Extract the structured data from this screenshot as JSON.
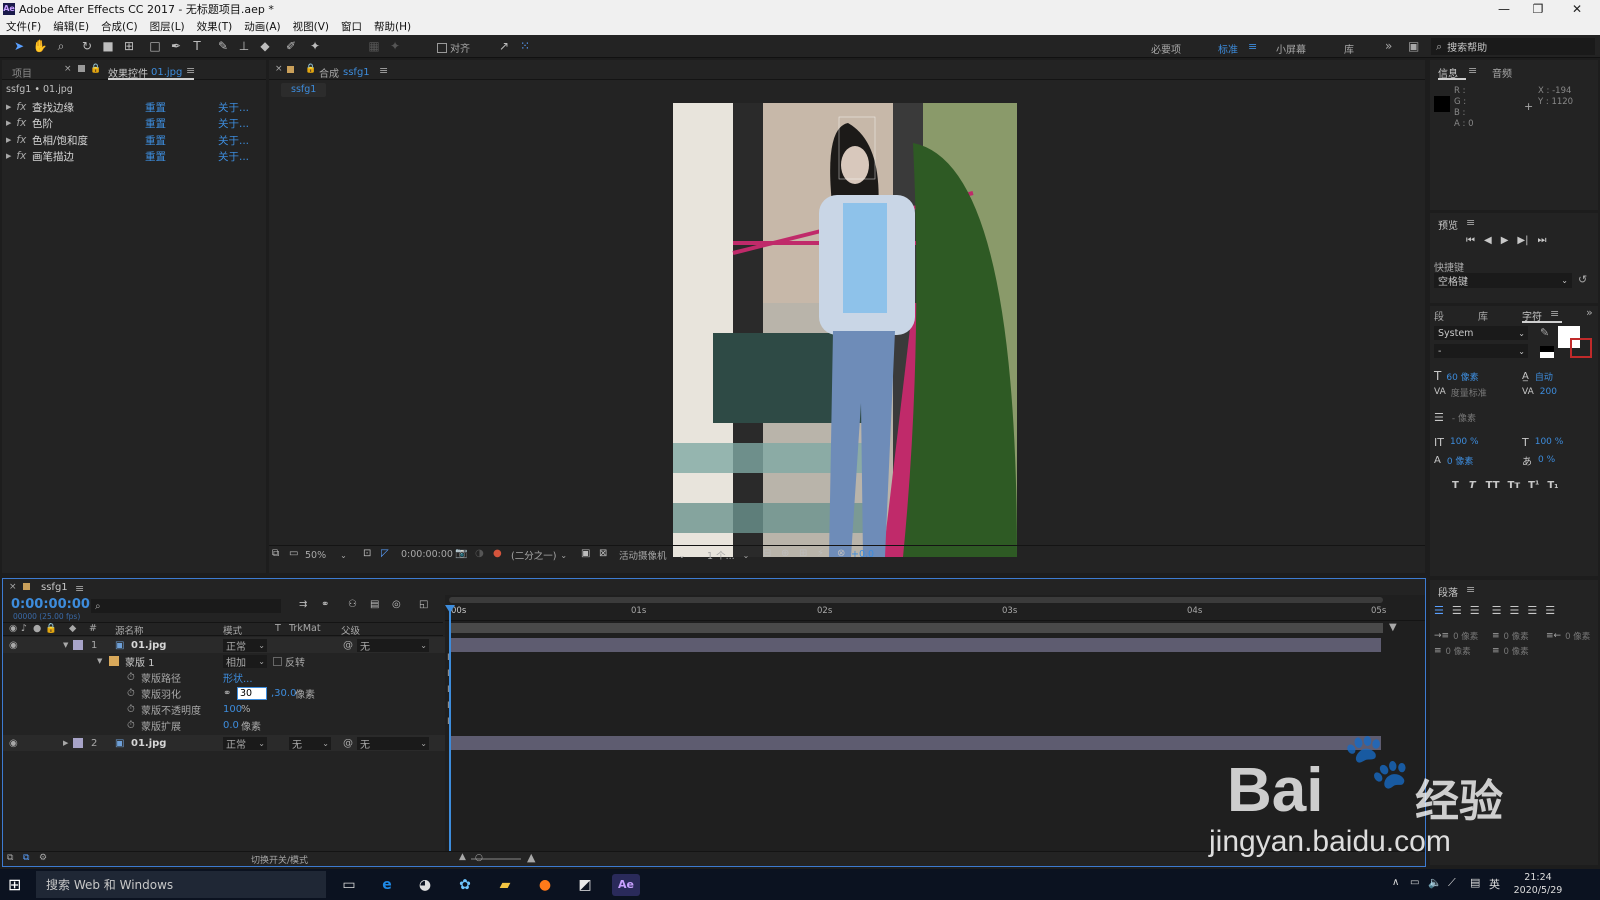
{
  "window": {
    "title": "Adobe After Effects CC 2017 - 无标题项目.aep *",
    "app_badge": "Ae",
    "min": "—",
    "max": "❐",
    "close": "✕"
  },
  "menu": [
    "文件(F)",
    "编辑(E)",
    "合成(C)",
    "图层(L)",
    "效果(T)",
    "动画(A)",
    "视图(V)",
    "窗口",
    "帮助(H)"
  ],
  "toolbar": {
    "align_label": "对齐",
    "workspaces": [
      "必要项",
      "标准",
      "小屏幕",
      "库"
    ],
    "active_workspace": "标准",
    "search_placeholder": "搜索帮助"
  },
  "project_panel": {
    "tab_project": "项目",
    "tab_effects": "效果控件",
    "effects_target": "01.jpg",
    "breadcrumb": "ssfg1 • 01.jpg",
    "effects": [
      {
        "name": "查找边缘",
        "reset": "重置",
        "about": "关于..."
      },
      {
        "name": "色阶",
        "reset": "重置",
        "about": "关于..."
      },
      {
        "name": "色相/饱和度",
        "reset": "重置",
        "about": "关于..."
      },
      {
        "name": "画笔描边",
        "reset": "重置",
        "about": "关于..."
      }
    ]
  },
  "comp_panel": {
    "tab_prefix": "合成",
    "comp_name": "ssfg1",
    "breadcrumb": "ssfg1",
    "footer": {
      "zoom": "50%",
      "timecode": "0:00:00:00",
      "resolution": "(二分之一)",
      "camera": "活动摄像机",
      "views": "1 个...",
      "exposure": "+0.0"
    }
  },
  "info_panel": {
    "tab_info": "信息",
    "tab_audio": "音频",
    "r": "R :",
    "g": "G :",
    "b": "B :",
    "a": "A : 0",
    "x": "X : -194",
    "y": "Y : 1120"
  },
  "preview_panel": {
    "title": "预览",
    "shortcut_label": "快捷键",
    "shortcut_value": "空格键"
  },
  "character_panel": {
    "tab_para": "段",
    "tab_lib": "库",
    "tab_char": "字符",
    "font": "System",
    "style": "-",
    "size": "60 像素",
    "leading": "自动",
    "kerning": "度量标准",
    "tracking": "200",
    "stroke": "- 像素",
    "vscale": "100 %",
    "hscale": "100 %",
    "baseline": "0 像素",
    "tsume": "0 %",
    "styles": [
      "T",
      "T",
      "TT",
      "Tт",
      "T¹",
      "T₁"
    ]
  },
  "paragraph_panel": {
    "title": "段落",
    "indent_left": "0 像素",
    "indent_first": "0 像素",
    "indent_right": "0 像素",
    "space_before": "0 像素",
    "space_after": "0 像素"
  },
  "timeline": {
    "comp_name": "ssfg1",
    "timecode": "0:00:00:00",
    "timecode_sub": "00000 (25.00 fps)",
    "headers": {
      "num": "#",
      "source": "源名称",
      "mode": "模式",
      "t": "T",
      "trkmat": "TrkMat",
      "parent": "父级"
    },
    "ruler": [
      "00s",
      "01s",
      "02s",
      "03s",
      "04s",
      "05s"
    ],
    "layers": [
      {
        "num": "1",
        "name": "01.jpg",
        "mode": "正常",
        "parent": "无"
      },
      {
        "num": "2",
        "name": "01.jpg",
        "mode": "正常",
        "trkmat": "无",
        "parent": "无"
      }
    ],
    "mask": {
      "name": "蒙版 1",
      "mode": "相加",
      "invert": "反转",
      "path_label": "蒙版路径",
      "path_value": "形状...",
      "feather_label": "蒙版羽化",
      "feather_x": "30",
      "feather_y": ",30.0",
      "feather_unit": "像素",
      "opacity_label": "蒙版不透明度",
      "opacity_value": "100",
      "opacity_unit": "%",
      "expansion_label": "蒙版扩展",
      "expansion_value": "0.0",
      "expansion_unit": "像素"
    },
    "footer_label": "切换开关/模式"
  },
  "taskbar": {
    "search": "搜索 Web 和 Windows",
    "time": "21:24",
    "date": "2020/5/29",
    "ime": "英"
  },
  "watermark": {
    "brand": "Bai",
    "brand2": "经验",
    "url": "jingyan.baidu.com"
  }
}
